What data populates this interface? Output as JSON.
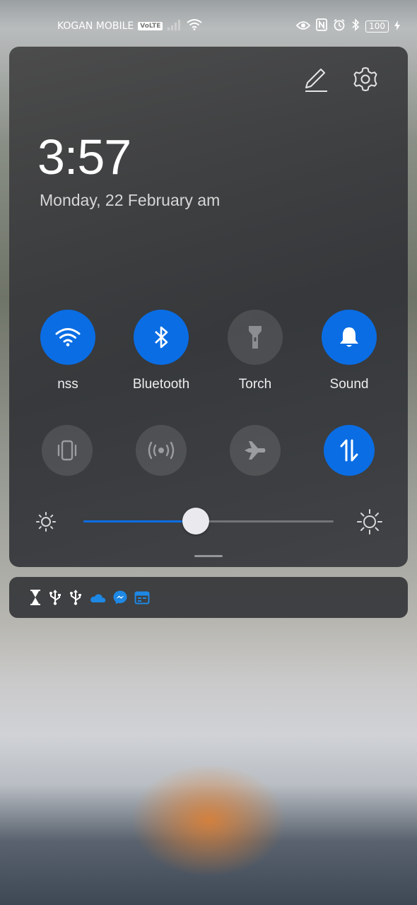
{
  "status_bar": {
    "carrier": "KOGAN MOBILE",
    "volte": "VoLTE",
    "battery": "100",
    "icons": [
      "signal-icon",
      "wifi-icon",
      "eye-icon",
      "nfc-icon",
      "alarm-icon",
      "bluetooth-icon",
      "battery-icon",
      "charging-icon"
    ]
  },
  "header": {
    "time": "3:57",
    "date": "Monday, 22 February  am",
    "actions": [
      "edit-icon",
      "settings-icon"
    ]
  },
  "toggles": [
    {
      "label": "nss",
      "icon": "wifi-icon",
      "active": true
    },
    {
      "label": "Bluetooth",
      "icon": "bluetooth-icon",
      "active": true
    },
    {
      "label": "Torch",
      "icon": "torch-icon",
      "active": false
    },
    {
      "label": "Sound",
      "icon": "bell-icon",
      "active": true
    }
  ],
  "toggles_row2": [
    {
      "icon": "vibrate-icon",
      "active": false
    },
    {
      "icon": "hotspot-icon",
      "active": false
    },
    {
      "icon": "airplane-icon",
      "active": false
    },
    {
      "icon": "mobile-data-icon",
      "active": true
    }
  ],
  "brightness": {
    "level": 0.45
  },
  "notification_icons": [
    "hourglass-icon",
    "usb-icon",
    "usb-icon",
    "onedrive-icon",
    "messenger-icon",
    "calendar-icon"
  ],
  "colors": {
    "accent": "#0a6de4",
    "inactive": "#5a5c60"
  }
}
